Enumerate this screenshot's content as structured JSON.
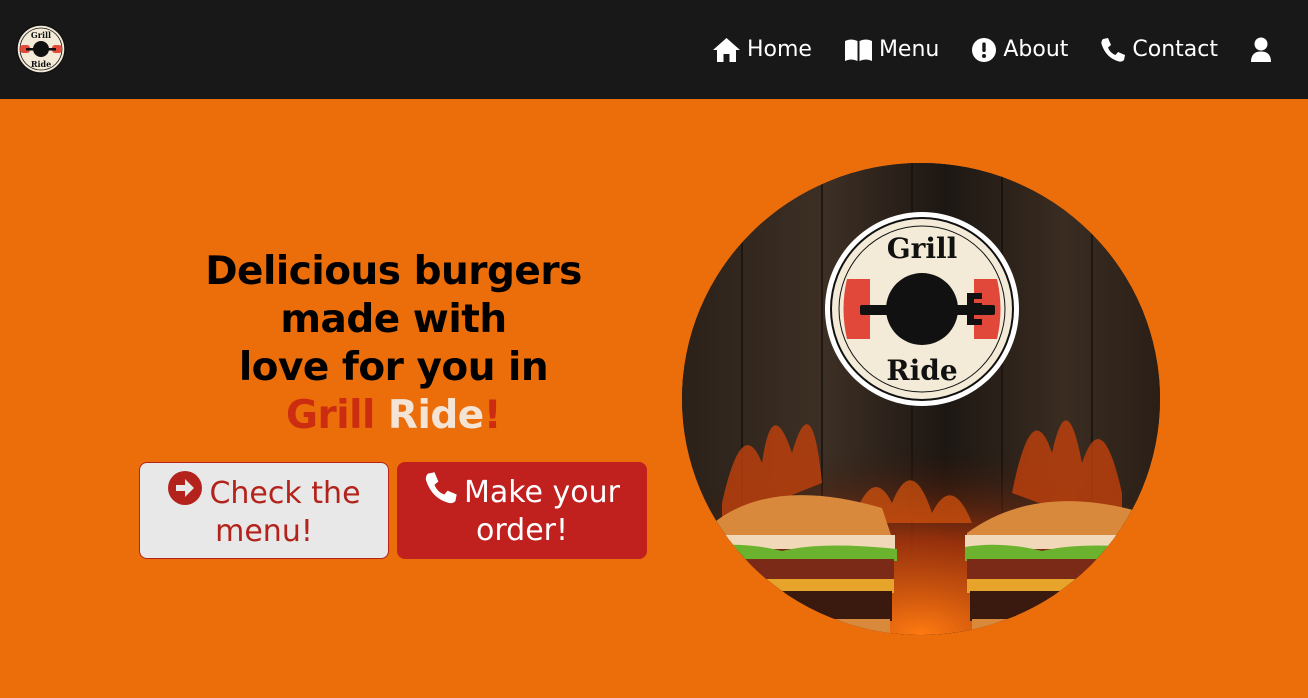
{
  "logo": {
    "top_text": "Grill",
    "bottom_text": "Ride"
  },
  "nav": {
    "items": [
      {
        "label": "Home",
        "icon": "home-icon"
      },
      {
        "label": "Menu",
        "icon": "book-icon"
      },
      {
        "label": "About",
        "icon": "exclamation-circle-icon"
      },
      {
        "label": "Contact",
        "icon": "phone-icon"
      }
    ],
    "user_icon": "user-icon"
  },
  "hero": {
    "line1": "Delicious burgers",
    "line2": "made with",
    "line3": "love for you in",
    "brand_part1": "Grill",
    "brand_part2": "Ride",
    "brand_punct": "!"
  },
  "buttons": {
    "menu_label_1": "Check the",
    "menu_label_2": "menu!",
    "order_label_1": "Make your",
    "order_label_2": "order!"
  },
  "image": {
    "badge_top": "Grill",
    "badge_bottom": "Ride"
  },
  "colors": {
    "background": "#ec6e0a",
    "navbar": "#181818",
    "brand_red": "#cc2c10",
    "button_red": "#c0201e"
  }
}
